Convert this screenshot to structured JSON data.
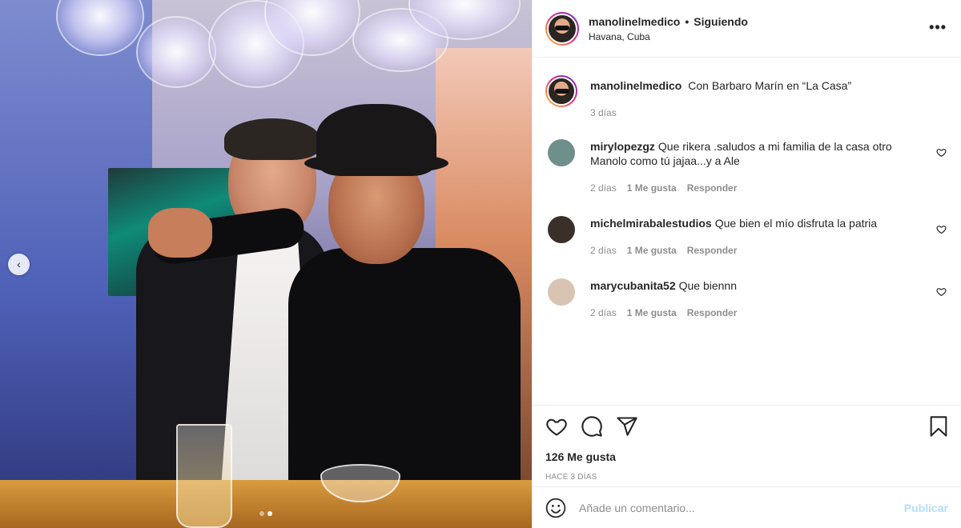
{
  "post": {
    "username": "manolinelmedico",
    "follow_status": "Siguiendo",
    "location": "Havana, Cuba",
    "caption": "Con Barbaro Marín en “La Casa”",
    "caption_age": "3 días"
  },
  "carousel": {
    "prev_glyph": "‹",
    "slide_count": 2,
    "active_slide": 2
  },
  "comments": [
    {
      "username": "mirylopezgz",
      "text": "Que rikera .saludos a mi familia de la casa otro Manolo como tú jajaa...y a Ale",
      "age": "2 días",
      "likes": "1 Me gusta",
      "reply": "Responder",
      "avatar_color": "#6f8f8c"
    },
    {
      "username": "michelmirabalestudios",
      "text": "Que bien el mío disfruta la patria",
      "age": "2 días",
      "likes": "1 Me gusta",
      "reply": "Responder",
      "avatar_color": "#3b2f2a"
    },
    {
      "username": "marycubanita52",
      "text": "Que biennn",
      "age": "2 días",
      "likes": "1 Me gusta",
      "reply": "Responder",
      "avatar_color": "#d9c3b2"
    }
  ],
  "stats": {
    "likes_label": "126 Me gusta",
    "time_ago": "HACE 3 DÍAS"
  },
  "add_comment": {
    "placeholder": "Añade un comentario...",
    "publish_label": "Publicar"
  },
  "icons": [
    "heart-icon",
    "comment-icon",
    "share-icon",
    "bookmark-icon",
    "emoji-icon",
    "more-icon"
  ],
  "colors": {
    "link_disabled": "#b2dffc",
    "meta": "#8e8e8e",
    "text": "#262626"
  }
}
